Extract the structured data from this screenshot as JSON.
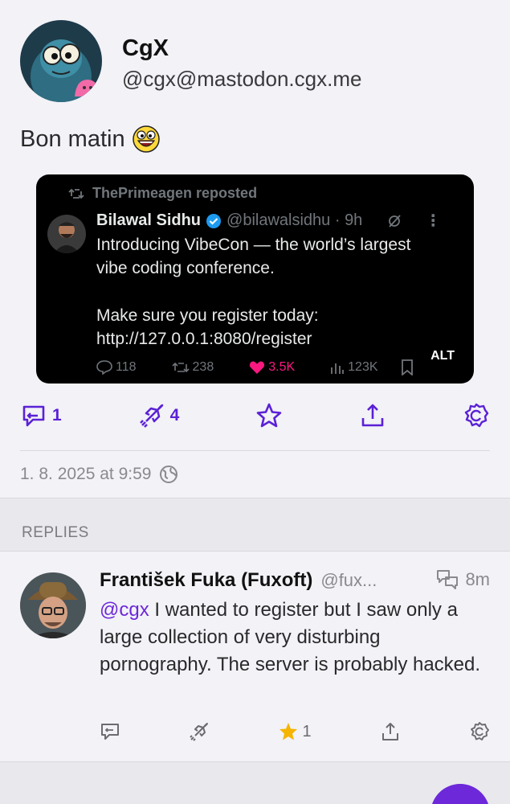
{
  "post": {
    "author_name": "CgX",
    "author_handle": "@cgx@mastodon.cgx.me",
    "content": "Bon matin",
    "emoji_icon": "grinning-face-emoji-icon",
    "media": {
      "repost_label": "ThePrimeagen reposted",
      "tweet_author": "Bilawal Sidhu",
      "tweet_handle_time": "@bilawalsidhu · 9h",
      "tweet_lines": [
        "Introducing VibeCon — the world’s largest",
        "vibe coding conference.",
        "Make sure you register today:",
        "http://127.0.0.1:8080/register"
      ],
      "stats": {
        "replies": "118",
        "reposts": "238",
        "likes": "3.5K",
        "views": "123K"
      },
      "alt_label": "ALT"
    },
    "actions": {
      "reply_count": "1",
      "boost_count": "4"
    },
    "timestamp": "1. 8. 2025 at 9:59"
  },
  "replies_header": "REPLIES",
  "reply": {
    "author_name": "František Fuka (Fuxoft)",
    "author_handle": "@fux...",
    "time": "8m",
    "mention": "@cgx",
    "text": " I wanted to register but I saw only a large collection of very disturbing pornography. The server is probably hacked.",
    "favourite_count": "1"
  },
  "colors": {
    "accent": "#5b21d6",
    "star": "#f5b400",
    "like": "#f91880"
  }
}
